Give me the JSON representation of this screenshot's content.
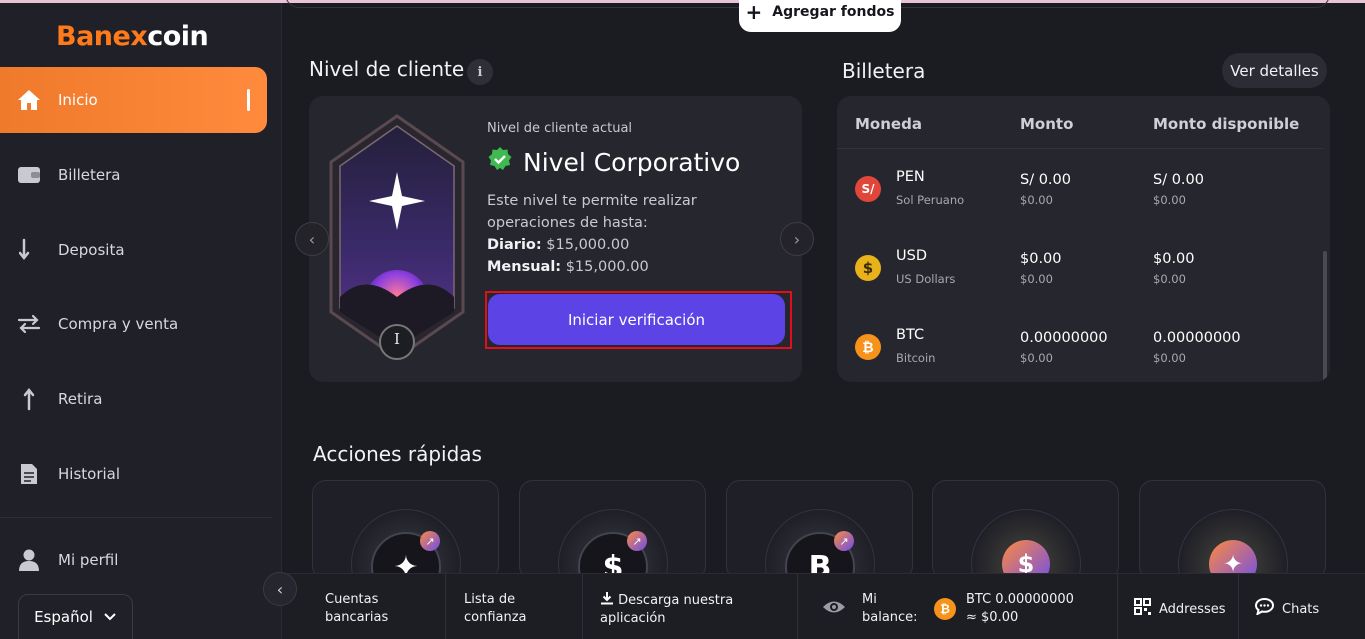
{
  "brand": {
    "name_part1": "Banex",
    "name_part2": "coin"
  },
  "sidebar": {
    "items": [
      {
        "label": "Inicio",
        "icon": "home-icon"
      },
      {
        "label": "Billetera",
        "icon": "wallet-icon"
      },
      {
        "label": "Deposita",
        "icon": "deposit-arrow-icon"
      },
      {
        "label": "Compra y venta",
        "icon": "swap-icon"
      },
      {
        "label": "Retira",
        "icon": "withdraw-arrow-icon"
      },
      {
        "label": "Historial",
        "icon": "document-icon"
      },
      {
        "label": "Mi perfil",
        "icon": "user-icon"
      }
    ],
    "language": "Español"
  },
  "header": {
    "add_funds": "Agregar fondos"
  },
  "client_level": {
    "title": "Nivel de cliente",
    "current_label": "Nivel de cliente actual",
    "level_name": "Nivel Corporativo",
    "description": "Este nivel te permite realizar operaciones de hasta:",
    "daily_label": "Diario:",
    "daily_value": "$15,000.00",
    "monthly_label": "Mensual:",
    "monthly_value": "$15,000.00",
    "verify_button": "Iniciar verificación",
    "badge_numeral": "I"
  },
  "wallet": {
    "title": "Billetera",
    "details_button": "Ver detalles",
    "columns": [
      "Moneda",
      "Monto",
      "Monto disponible"
    ],
    "rows": [
      {
        "symbol": "S/",
        "code": "PEN",
        "name": "Sol Peruano",
        "amount": "S/ 0.00",
        "amount_fiat": "$0.00",
        "available": "S/ 0.00",
        "available_fiat": "$0.00",
        "color": "#e0463a"
      },
      {
        "symbol": "$",
        "code": "USD",
        "name": "US Dollars",
        "amount": "$0.00",
        "amount_fiat": "$0.00",
        "available": "$0.00",
        "available_fiat": "$0.00",
        "color": "#e8b21b"
      },
      {
        "symbol": "₿",
        "code": "BTC",
        "name": "Bitcoin",
        "amount": "0.00000000",
        "amount_fiat": "$0.00",
        "available": "0.00000000",
        "available_fiat": "$0.00",
        "color": "#f7931a"
      }
    ]
  },
  "quick_actions": {
    "title": "Acciones rápidas",
    "cards": [
      {
        "icon": "sparkle-icon",
        "glyph": "✦"
      },
      {
        "icon": "dollar-icon",
        "glyph": "$"
      },
      {
        "icon": "banexcoin-b-icon",
        "glyph": "B"
      },
      {
        "icon": "dollar-coin-icon",
        "glyph": "$"
      },
      {
        "icon": "sparkle-coin-icon",
        "glyph": "✦"
      }
    ]
  },
  "bottom_bar": {
    "bank_accounts": "Cuentas bancarias",
    "trust_list": "Lista de confianza",
    "download_app": "Descarga nuestra aplicación",
    "balance_label": "Mi balance:",
    "balance_value": "BTC 0.00000000 ≈ $0.00",
    "addresses": "Addresses",
    "chats": "Chats"
  }
}
